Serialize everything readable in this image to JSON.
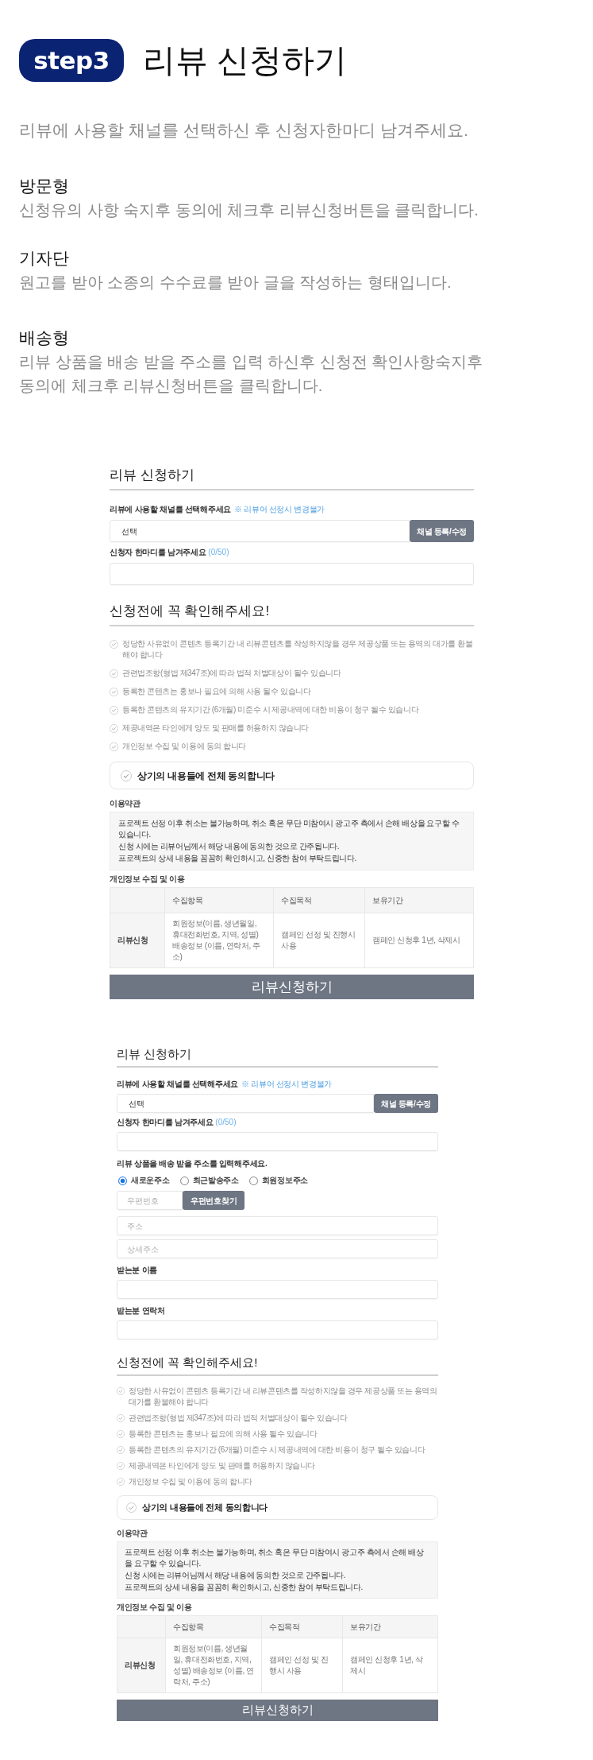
{
  "header": {
    "step_badge": "step3",
    "title": "리뷰 신청하기",
    "intro": "리뷰에 사용할 채널를 선택하신 후 신청자한마디 남겨주세요."
  },
  "types": [
    {
      "name": "방문형",
      "description": "신청유의 사항 숙지후 동의에 체크후 리뷰신청버튼을 클릭합니다."
    },
    {
      "name": "기자단",
      "description": "원고를 받아 소종의 수수료를 받아 글을 작성하는 형태입니다."
    },
    {
      "name": "배송형",
      "description": "리뷰 상품을 배송 받을 주소를 입력 하신후 신청전 확인사항숙지후 동의에 체크후 리뷰신청버튼을 클릭합니다."
    }
  ],
  "forms": [
    {
      "kind": "basic",
      "title": "리뷰 신청하기",
      "channel_label": "리뷰에 사용할 채널를 선택해주세요",
      "channel_note": "※ 리뷰어 선정시 변경불가",
      "channel_value": "선택",
      "channel_button": "채널 등록/수정",
      "comment_label": "신청자 한마디를 남겨주세요",
      "comment_count": "(0/50)",
      "notice_heading": "신청전에 꼭 확인해주세요!",
      "notices": [
        "정당한 사유없이 콘텐츠 등록기간 내 리뷰콘텐츠를 작성하지않을 경우 제공상품 또는 용역의 대가를 환불해야 합니다",
        "관련법조항(형법 제347조)에 따라 법적 처벌대상이 될수 있습니다",
        "등록한 콘텐츠는 홍보나 필요에 의해 사용 될수 있습니다",
        "등록한 콘텐츠의 유지기간 (6개월) 미준수 시 제공내역에 대한 비용이 청구 될수 있습니다",
        "제공내역은 타인에게 양도 및 판매를 허용하지 않습니다",
        "개인정보 수집 및 이용에 동의 합니다"
      ],
      "agree_all": {
        "label": "상기의 내용들에 전체 동의합니다",
        "checked": false
      },
      "terms_title": "이용약관",
      "terms_lines": [
        "프로젝트 선정 이후 취소는 불가능하며, 취소 혹은 무단 미참여시 광고주 측에서 손해 배상을 요구할 수 있습니다.",
        "신청 시에는 리뷰어님께서 해당 내용에 동의한 것으로 간주됩니다.",
        "프로젝트의 상세 내용을 꼼꼼히 확인하시고, 신중한 참여 부탁드립니다."
      ],
      "privacy_title": "개인정보 수집 및 이용",
      "table": {
        "columns": [
          "수집항목",
          "수집목적",
          "보유기간"
        ],
        "rows": [
          {
            "label": "리뷰신청",
            "cells": [
              "회원정보(이름, 생년월일, 휴대전화번호, 지역, 성별) 배송정보 (이름, 연락처, 주소)",
              "캠페인 선정 및 진행시 사용",
              "캠페인 신청후 1년, 삭제시"
            ]
          }
        ]
      },
      "submit": "리뷰신청하기"
    },
    {
      "kind": "delivery",
      "title": "리뷰 신청하기",
      "channel_label": "리뷰에 사용할 채널를 선택해주세요",
      "channel_note": "※ 리뷰어 선정시 변경불가",
      "channel_value": "선택",
      "channel_button": "채널 등록/수정",
      "comment_label": "신청자 한마디를 남겨주세요",
      "comment_count": "(0/50)",
      "address": {
        "label": "리뷰 상품을 배송 받을 주소를 입력해주세요.",
        "options": [
          {
            "label": "새로운주소",
            "selected": true
          },
          {
            "label": "최근발송주소",
            "selected": false
          },
          {
            "label": "회원정보주소",
            "selected": false
          }
        ],
        "postcode_placeholder": "우편번호",
        "postcode_button": "우편번호찾기",
        "address_placeholder": "주소",
        "detail_placeholder": "상세주소",
        "recipient_name_label": "받는분 이름",
        "recipient_phone_label": "받는분 연락처"
      },
      "notice_heading": "신청전에 꼭 확인해주세요!",
      "notices": [
        "정당한 사유없이 콘텐츠 등록기간 내 리뷰콘텐츠를 작성하지않을 경우 제공상품 또는 용역의 대가를 환불해야 합니다",
        "관련법조항(형법 제347조)에 따라 법적 처벌대상이 될수 있습니다",
        "등록한 콘텐츠는 홍보나 필요에 의해 사용 될수 있습니다",
        "등록한 콘텐츠의 유지기간 (6개월) 미준수 시 제공내역에 대한 비용이 청구 될수 있습니다",
        "제공내역은 타인에게 양도 및 판매를 허용하지 않습니다",
        "개인정보 수집 및 이용에 동의 합니다"
      ],
      "agree_all": {
        "label": "상기의 내용들에 전체 동의합니다",
        "checked": false
      },
      "terms_title": "이용약관",
      "terms_lines": [
        "프로젝트 선정 이후 취소는 불가능하며, 취소 혹은 무단 미참여시 광고주 측에서 손해 배상을 요구할 수 있습니다.",
        "신청 시에는 리뷰어님께서 해당 내용에 동의한 것으로 간주됩니다.",
        "프로젝트의 상세 내용을 꼼꼼히 확인하시고, 신중한 참여 부탁드립니다."
      ],
      "privacy_title": "개인정보 수집 및 이용",
      "table": {
        "columns": [
          "수집항목",
          "수집목적",
          "보유기간"
        ],
        "rows": [
          {
            "label": "리뷰신청",
            "cells": [
              "회원정보(이름, 생년월일, 휴대전화번호, 지역, 성별) 배송정보 (이름, 연락처, 주소)",
              "캠페인 선정 및 진행시 사용",
              "캠페인 신청후 1년, 삭제시"
            ]
          }
        ]
      },
      "submit": "리뷰신청하기"
    }
  ]
}
